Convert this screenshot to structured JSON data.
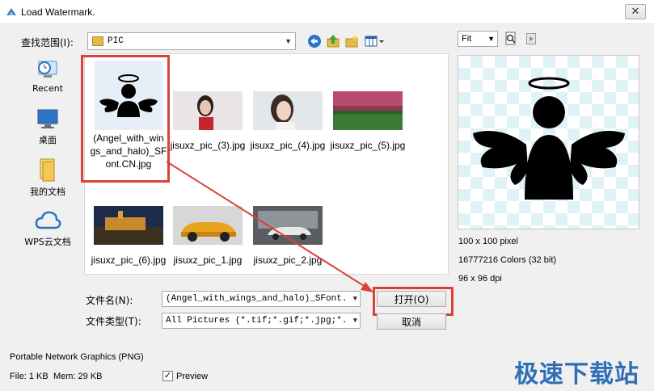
{
  "window": {
    "title": "Load Watermark.",
    "close_glyph": "✕"
  },
  "lookin": {
    "label": "查找范围(I):",
    "value": "PIC"
  },
  "toolbar_icons": [
    "back-icon",
    "up-folder-icon",
    "new-folder-icon",
    "view-menu-icon"
  ],
  "places": [
    {
      "label": "Recent",
      "icon": "recent-icon"
    },
    {
      "label": "桌面",
      "icon": "desktop-icon"
    },
    {
      "label": "我的文档",
      "icon": "documents-icon"
    },
    {
      "label": "WPS云文档",
      "icon": "cloud-icon"
    }
  ],
  "files": [
    {
      "name": "(Angel_with_wings_and_halo)_SFont.CN.jpg",
      "name_lines": [
        "(Angel_with_win",
        "gs_and_halo)_SF",
        "ont.CN.jpg"
      ],
      "selected": true
    },
    {
      "name": "jisuxz_pic_(3).jpg"
    },
    {
      "name": "jisuxz_pic_(4).jpg"
    },
    {
      "name": "jisuxz_pic_(5).jpg"
    },
    {
      "name": "jisuxz_pic_(6).jpg"
    },
    {
      "name": "jisuxz_pic_1.jpg"
    },
    {
      "name": "jisuxz_pic_2.jpg"
    }
  ],
  "filename": {
    "label": "文件名(N):",
    "value": "(Angel_with_wings_and_halo)_SFont.CN."
  },
  "filetype": {
    "label": "文件类型(T):",
    "value": "All Pictures (*.tif;*.gif;*.jpg;*.pcx"
  },
  "buttons": {
    "open": "打开(O)",
    "cancel": "取消"
  },
  "preview": {
    "zoom": "Fit",
    "size": "100 x 100 pixel",
    "colors": "16777216 Colors (32 bit)",
    "dpi": "96 x 96 dpi",
    "checkbox_label": "Preview",
    "checked": true,
    "check_glyph": "✓"
  },
  "status": {
    "format": "Portable Network Graphics (PNG)",
    "file_size": "File: 1 KB",
    "mem": "Mem: 29 KB"
  },
  "watermark": "极速下载站",
  "colors": {
    "highlight": "#d9413b",
    "accent": "#2f6fb6"
  }
}
